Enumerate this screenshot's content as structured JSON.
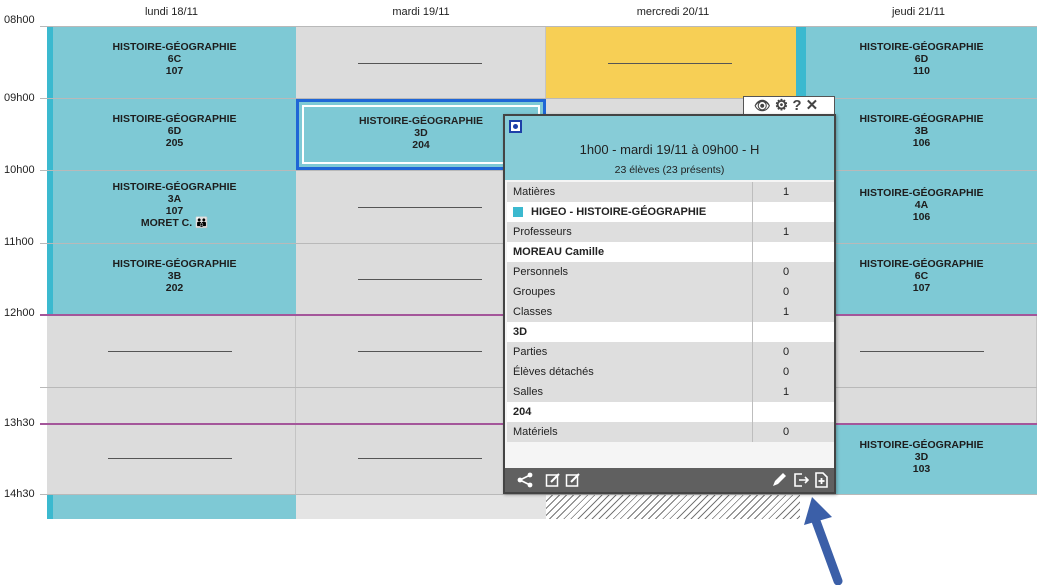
{
  "days": [
    "lundi 18/11",
    "mardi 19/11",
    "mercredi 20/11",
    "jeudi 21/11"
  ],
  "hours": [
    "08h00",
    "09h00",
    "10h00",
    "11h00",
    "12h00",
    "13h30",
    "14h30"
  ],
  "courses": {
    "mon_1": {
      "subject": "HISTOIRE-GÉOGRAPHIE",
      "class": "6C",
      "room": "107"
    },
    "mon_2": {
      "subject": "HISTOIRE-GÉOGRAPHIE",
      "class": "6D",
      "room": "205"
    },
    "mon_3": {
      "subject": "HISTOIRE-GÉOGRAPHIE",
      "class": "3A",
      "room": "107",
      "teacher": "MORET C."
    },
    "mon_4": {
      "subject": "HISTOIRE-GÉOGRAPHIE",
      "class": "3B",
      "room": "202"
    },
    "tue_1": {
      "subject": "HISTOIRE-GÉOGRAPHIE",
      "class": "3D",
      "room": "204"
    },
    "thu_1": {
      "subject": "HISTOIRE-GÉOGRAPHIE",
      "class": "6D",
      "room": "110"
    },
    "thu_2": {
      "subject": "HISTOIRE-GÉOGRAPHIE",
      "class": "3B",
      "room": "106"
    },
    "thu_3": {
      "subject": "HISTOIRE-GÉOGRAPHIE",
      "class": "4A",
      "room": "106"
    },
    "thu_4": {
      "subject": "HISTOIRE-GÉOGRAPHIE",
      "class": "6C",
      "room": "107"
    },
    "thu_5": {
      "subject": "HISTOIRE-GÉOGRAPHIE",
      "class": "3D",
      "room": "103"
    }
  },
  "popup": {
    "title": "1h00 - mardi 19/11 à 09h00 - H",
    "subtitle": "23 élèves (23 présents)",
    "rows": [
      {
        "label": "Matières",
        "value": "1",
        "style": "grey"
      },
      {
        "label": "HIGEO - HISTOIRE-GÉOGRAPHIE",
        "value": "",
        "style": "white"
      },
      {
        "label": "Professeurs",
        "value": "1",
        "style": "grey"
      },
      {
        "label": "MOREAU Camille",
        "value": "",
        "style": "white"
      },
      {
        "label": "Personnels",
        "value": "0",
        "style": "grey"
      },
      {
        "label": "Groupes",
        "value": "0",
        "style": "grey"
      },
      {
        "label": "Classes",
        "value": "1",
        "style": "grey"
      },
      {
        "label": "3D",
        "value": "",
        "style": "white"
      },
      {
        "label": "Parties",
        "value": "0",
        "style": "grey"
      },
      {
        "label": "Élèves détachés",
        "value": "0",
        "style": "grey"
      },
      {
        "label": "Salles",
        "value": "1",
        "style": "grey"
      },
      {
        "label": "204",
        "value": "",
        "style": "white"
      },
      {
        "label": "Matériels",
        "value": "0",
        "style": "grey"
      }
    ]
  },
  "colors": {
    "course": "#7ec9d5",
    "accent": "#3bb9cf",
    "yellow": "#f7cf55",
    "arrow": "#3b5fa8"
  }
}
